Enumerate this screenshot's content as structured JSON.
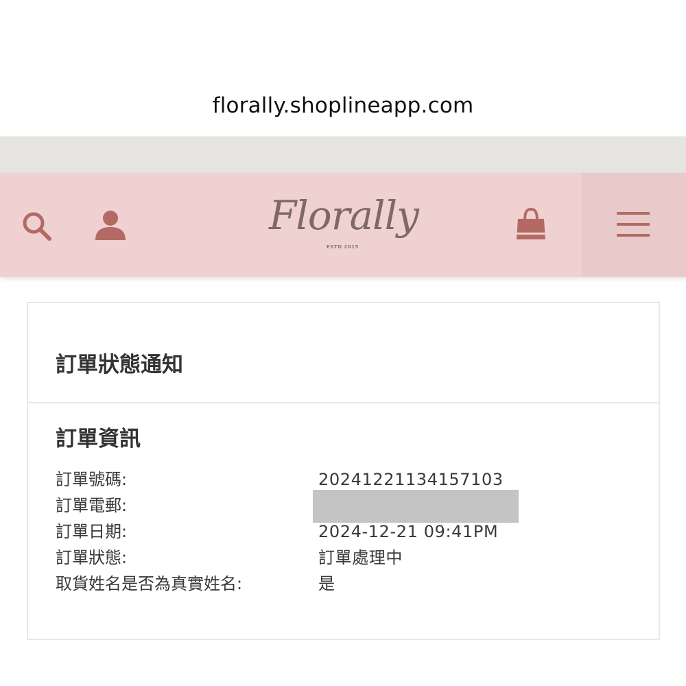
{
  "browser": {
    "url": "florally.shoplineapp.com"
  },
  "header": {
    "logo_text": "Florally",
    "logo_subtext": "ESTD 2015",
    "icons": [
      "search-icon",
      "user-icon",
      "shopping-bag-icon",
      "hamburger-menu-icon"
    ],
    "accent_color": "#b46a64",
    "background_color": "#efd1d2"
  },
  "page": {
    "title": "訂單狀態通知",
    "section_title": "訂單資訊",
    "fields": [
      {
        "label": "訂單號碼:",
        "value": "20241221134157103"
      },
      {
        "label": "訂單電郵:",
        "value": ""
      },
      {
        "label": "訂單日期:",
        "value": "2024-12-21 09:41PM"
      },
      {
        "label": "訂單狀態:",
        "value": "訂單處理中"
      },
      {
        "label": "取貨姓名是否為真實姓名:",
        "value": "是"
      }
    ]
  }
}
